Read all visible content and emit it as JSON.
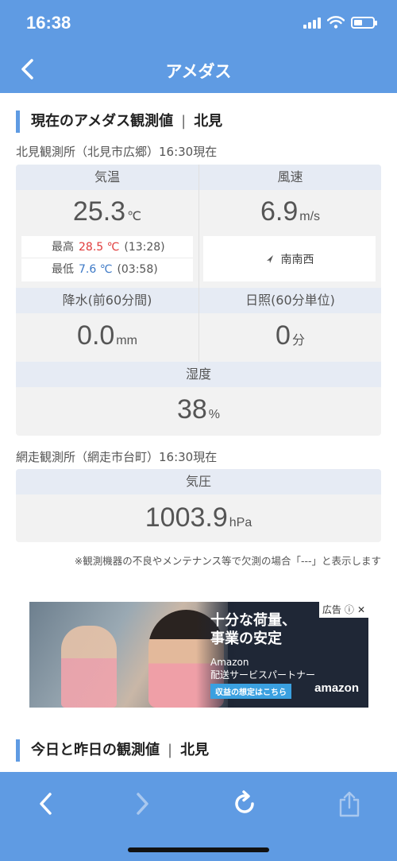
{
  "status_bar": {
    "time": "16:38",
    "battery_level": 0.45
  },
  "nav": {
    "title": "アメダス"
  },
  "current": {
    "section_title": "現在のアメダス観測値",
    "separator": "|",
    "location": "北見",
    "station1": "北見観測所（北見市広郷）16:30現在",
    "temp": {
      "header": "気温",
      "value": "25.3",
      "unit": "℃",
      "max_label": "最高",
      "max_value": "28.5 ℃",
      "max_time": "(13:28)",
      "min_label": "最低",
      "min_value": "7.6 ℃",
      "min_time": "(03:58)"
    },
    "wind": {
      "header": "風速",
      "value": "6.9",
      "unit": "m/s",
      "direction": "南南西"
    },
    "precip": {
      "header": "降水(前60分間)",
      "value": "0.0",
      "unit": "mm"
    },
    "sunshine": {
      "header": "日照(60分単位)",
      "value": "0",
      "unit": "分"
    },
    "humidity": {
      "header": "湿度",
      "value": "38",
      "unit": "%"
    },
    "station2": "網走観測所（網走市台町）16:30現在",
    "pressure": {
      "header": "気圧",
      "value": "1003.9",
      "unit": "hPa"
    },
    "note": "※観測機器の不良やメンテナンス等で欠測の場合「---」と表示します"
  },
  "ad": {
    "headline_line1": "十分な荷量、",
    "headline_line2": "事業の安定",
    "sub_line1": "Amazon",
    "sub_line2": "配送サービスパートナー",
    "cta": "収益の想定はこちら",
    "brand": "amazon",
    "badge": "広告"
  },
  "today_section": {
    "title": "今日と昨日の観測値",
    "separator": "|",
    "location": "北見"
  },
  "colors": {
    "accent": "#5f9be3",
    "max_temp": "#e03a3a",
    "min_temp": "#3b78c6"
  }
}
